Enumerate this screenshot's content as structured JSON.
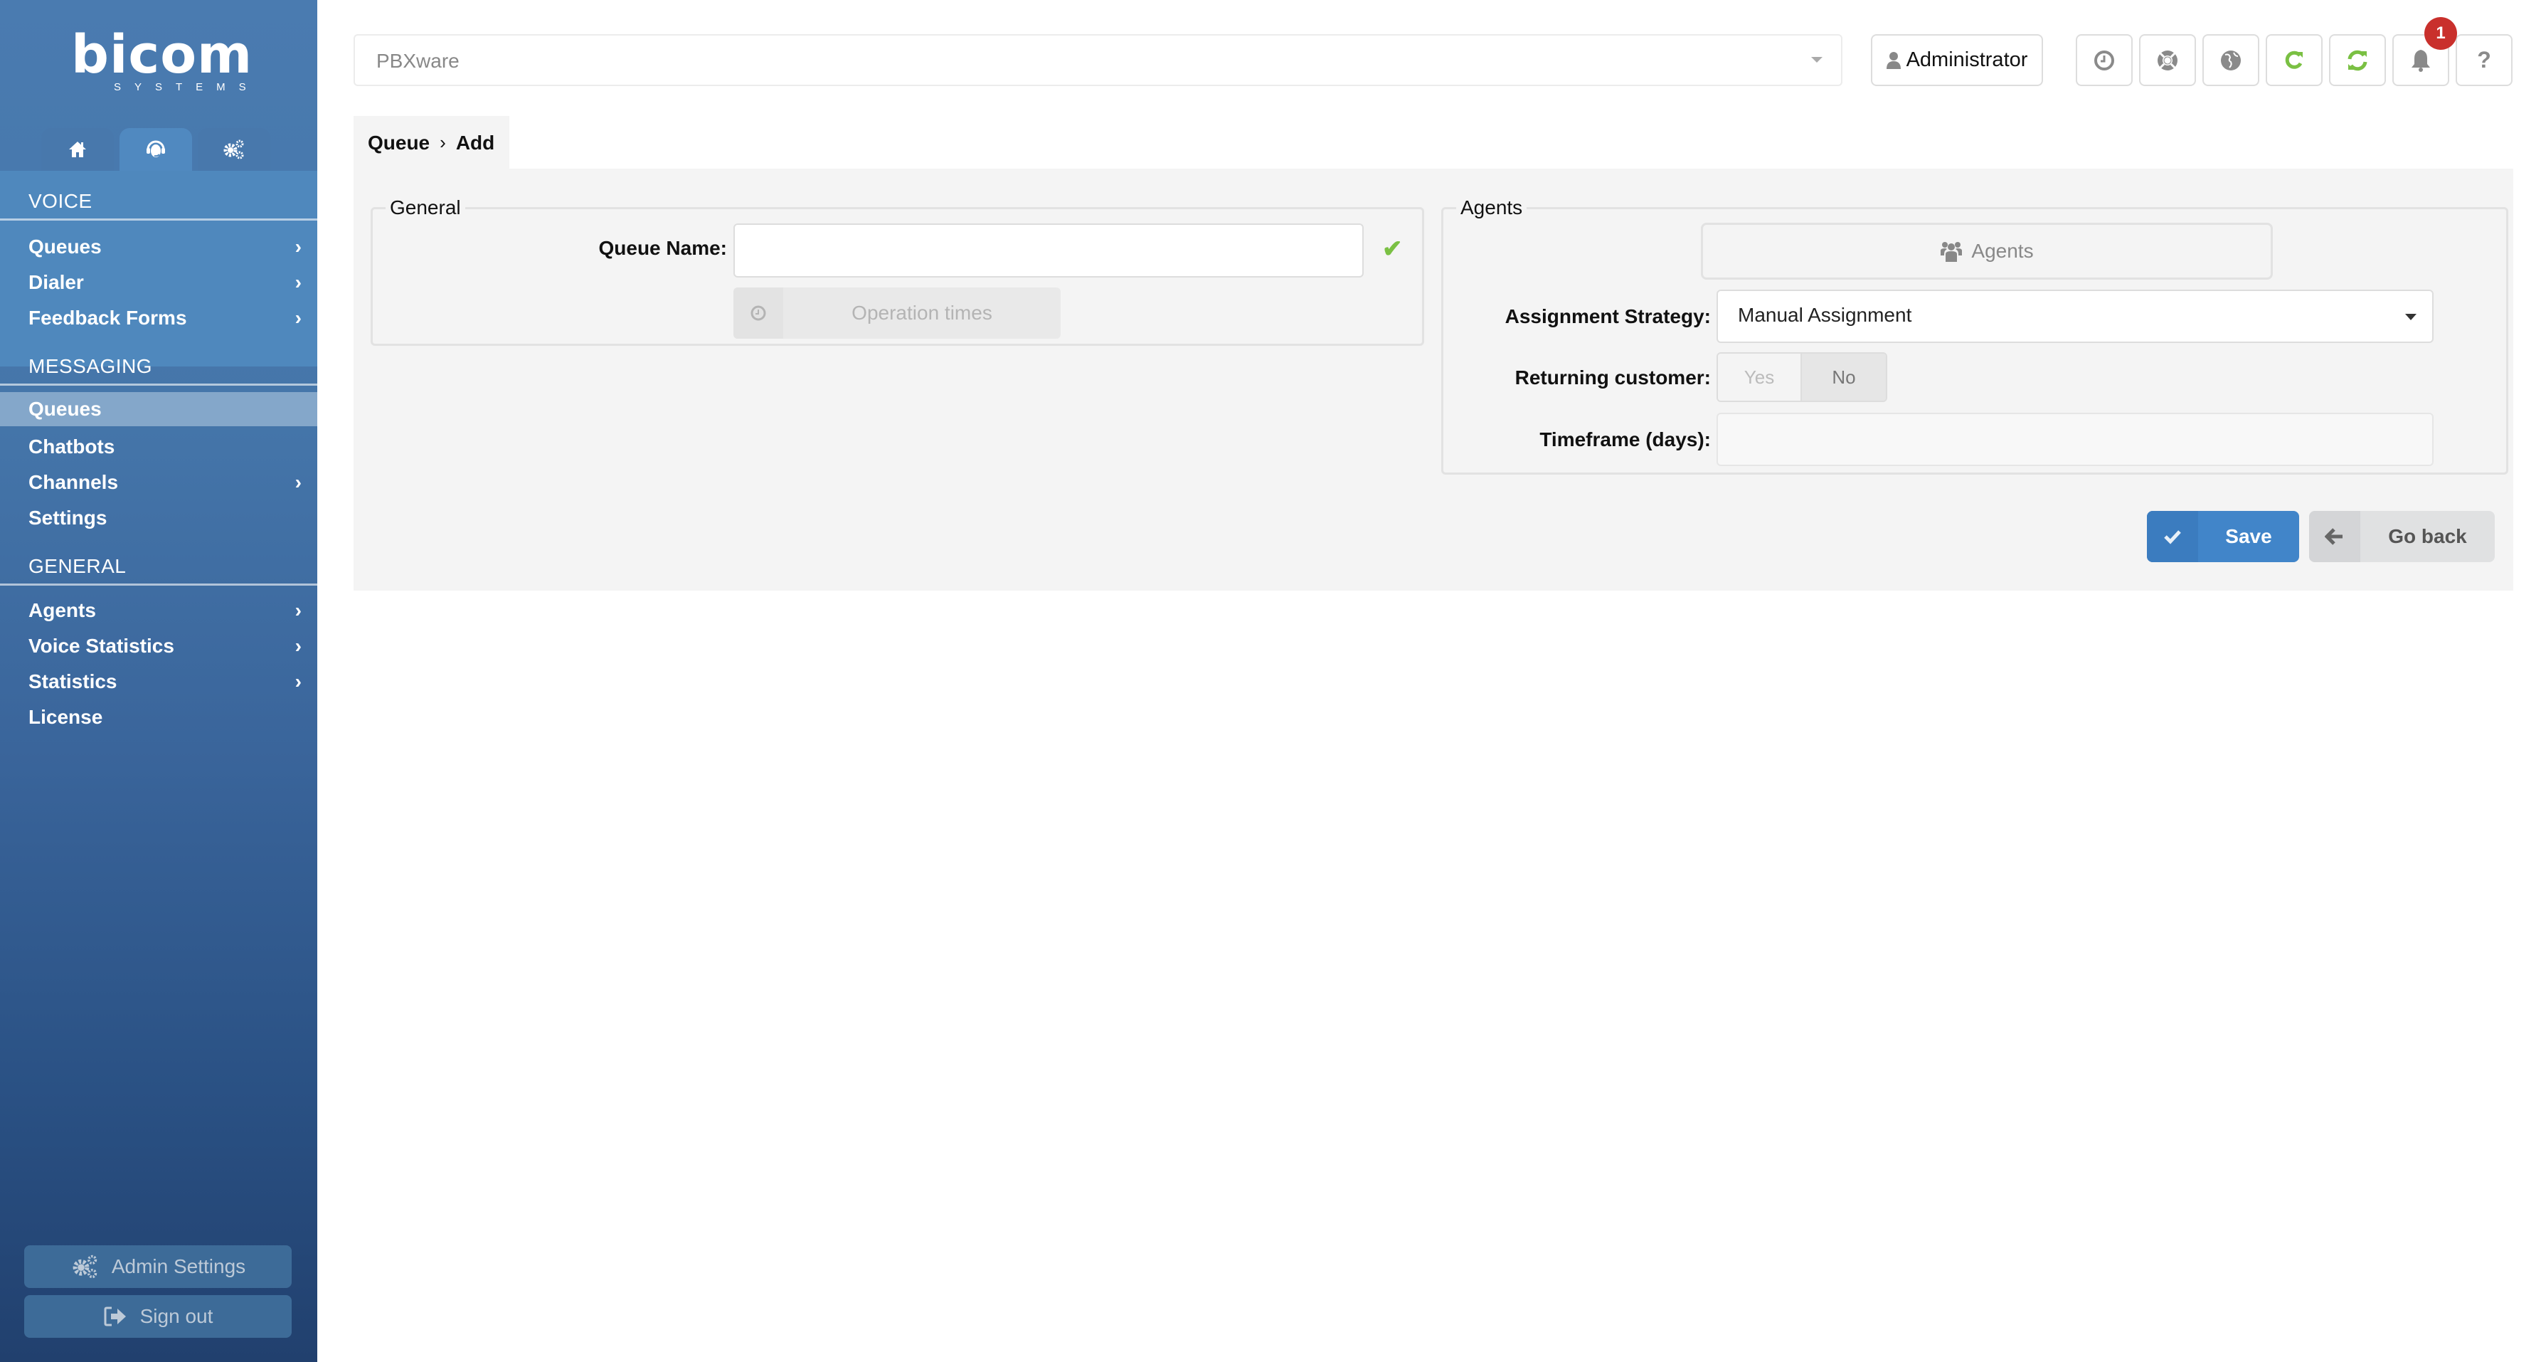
{
  "brand": {
    "logo_main": "bicom",
    "logo_sub": "SYSTEMS"
  },
  "sidebar": {
    "nav_tabs": [
      {
        "icon": "home-icon",
        "active": false
      },
      {
        "icon": "headset-icon",
        "active": true
      },
      {
        "icon": "gears-icon",
        "active": false
      }
    ],
    "sections": [
      {
        "title": "VOICE",
        "items": [
          {
            "label": "Queues",
            "has_submenu": true
          },
          {
            "label": "Dialer",
            "has_submenu": true
          },
          {
            "label": "Feedback Forms",
            "has_submenu": true
          }
        ]
      },
      {
        "title": "MESSAGING",
        "items": [
          {
            "label": "Queues",
            "has_submenu": false,
            "active": true
          },
          {
            "label": "Chatbots",
            "has_submenu": false
          },
          {
            "label": "Channels",
            "has_submenu": true
          },
          {
            "label": "Settings",
            "has_submenu": false
          }
        ]
      },
      {
        "title": "GENERAL",
        "items": [
          {
            "label": "Agents",
            "has_submenu": true
          },
          {
            "label": "Voice Statistics",
            "has_submenu": true
          },
          {
            "label": "Statistics",
            "has_submenu": true
          },
          {
            "label": "License",
            "has_submenu": false
          }
        ]
      }
    ],
    "chevron": "›",
    "admin_settings_label": "Admin Settings",
    "sign_out_label": "Sign out"
  },
  "topbar": {
    "system_select": {
      "value": "PBXware"
    },
    "user_button_label": "Administrator",
    "tools": [
      {
        "icon": "clock-icon",
        "color": "#8a8a8a"
      },
      {
        "icon": "lifebuoy-icon",
        "color": "#8a8a8a"
      },
      {
        "icon": "globe-icon",
        "color": "#8a8a8a"
      },
      {
        "icon": "reload-icon",
        "color": "#7ac043"
      },
      {
        "icon": "sync-icon",
        "color": "#7ac043"
      },
      {
        "icon": "bell-icon",
        "color": "#8a8a8a"
      },
      {
        "icon": "help-icon",
        "color": "#8a8a8a"
      }
    ],
    "notification_count": "1"
  },
  "breadcrumb": {
    "parent": "Queue",
    "separator": "›",
    "current": "Add"
  },
  "form": {
    "general": {
      "legend": "General",
      "queue_name_label": "Queue Name:",
      "queue_name_value": "",
      "operation_times_label": "Operation times"
    },
    "agents": {
      "legend": "Agents",
      "agents_button_label": "Agents",
      "assignment_strategy_label": "Assignment Strategy:",
      "assignment_strategy_value": "Manual Assignment",
      "returning_customer_label": "Returning customer:",
      "returning_customer_yes": "Yes",
      "returning_customer_no": "No",
      "returning_customer_selected": "No",
      "timeframe_label": "Timeframe (days):",
      "timeframe_value": ""
    },
    "save_label": "Save",
    "go_back_label": "Go back"
  },
  "colors": {
    "sidebar_top": "#4a7bb0",
    "sidebar_bottom": "#21406e",
    "primary": "#4185c9",
    "success": "#7ac043",
    "badge": "#c9302c",
    "panel_bg": "#f4f4f4"
  }
}
